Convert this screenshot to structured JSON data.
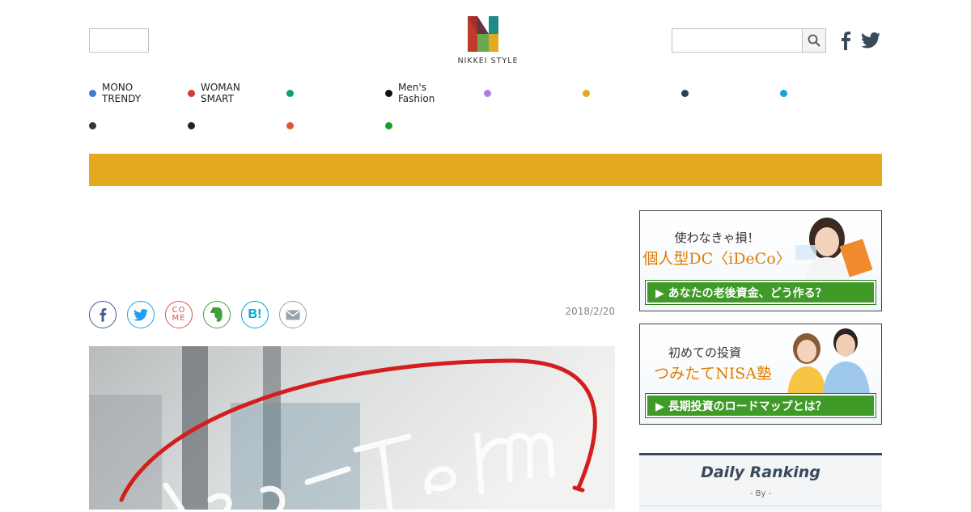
{
  "header": {
    "logo_text": "NIKKEI STYLE",
    "search_placeholder": ""
  },
  "nav": {
    "items": [
      {
        "label_line1": "MONO",
        "label_line2": "TRENDY",
        "color": "#3a7dd6"
      },
      {
        "label_line1": "WOMAN",
        "label_line2": "SMART",
        "color": "#d23b3b"
      },
      {
        "label_line1": "",
        "label_line2": "",
        "color": "#0e9c7c"
      },
      {
        "label_line1": "Men's",
        "label_line2": "Fashion",
        "color": "#111111"
      },
      {
        "label_line1": "",
        "label_line2": "",
        "color": "#b07de0"
      },
      {
        "label_line1": "",
        "label_line2": "",
        "color": "#e2a921"
      },
      {
        "label_line1": "",
        "label_line2": "",
        "color": "#2e3d5e"
      },
      {
        "label_line1": "",
        "label_line2": "",
        "color": "#1a9fe0"
      },
      {
        "label_line1": "",
        "label_line2": "",
        "color": "#333333"
      },
      {
        "label_line1": "",
        "label_line2": "",
        "color": "#222222"
      },
      {
        "label_line1": "",
        "label_line2": "",
        "color": "#e2553a"
      },
      {
        "label_line1": "",
        "label_line2": "",
        "color": "#15a02a"
      }
    ]
  },
  "colors": {
    "banner_bar": "#e2a921",
    "facebook": "#3b5998",
    "twitter": "#1da1f2",
    "come": "#d9534f",
    "evernote": "#3fa33a",
    "hatena": "#00a4de",
    "mail": "#9aa3ab",
    "ranking_accent": "#3b4a5a",
    "cta_green": "#3f9a27"
  },
  "article": {
    "date": "2018/2/20",
    "share_buttons": [
      "facebook-icon",
      "twitter-icon",
      "come-icon",
      "evernote-icon",
      "hatena-bookmark-icon",
      "mail-icon"
    ],
    "come_label_1": "CO",
    "come_label_2": "ME",
    "hatena_label": "B!",
    "hero_text": "Long-Term"
  },
  "sidebar": {
    "ad1": {
      "line1": "使わなきゃ損！",
      "line2": "個人型DC〈iDeCo〉",
      "cta": "▶ あなたの老後資金、どう作る？"
    },
    "ad2": {
      "line1": "初めての投資",
      "line2": "つみたてNISA塾",
      "cta": "▶ 長期投資のロードマップとは？"
    },
    "ranking": {
      "title": "Daily Ranking",
      "subtitle": "- By -"
    }
  }
}
